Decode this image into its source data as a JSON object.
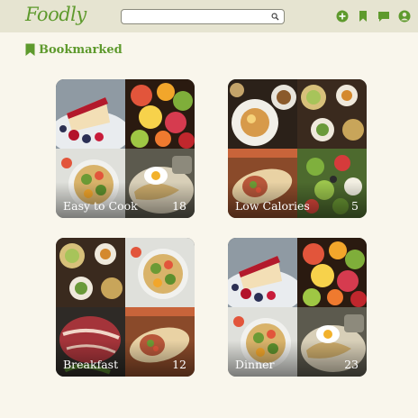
{
  "app": {
    "logo": "Foodly"
  },
  "search": {
    "placeholder": "",
    "value": ""
  },
  "nav": {
    "icons": [
      "add-circle-icon",
      "bookmark-icon",
      "chat-icon",
      "profile-icon"
    ]
  },
  "page": {
    "heading": "Bookmarked"
  },
  "collections": [
    {
      "name": "Easy to Cook",
      "count": "18",
      "images": [
        "cheesecake",
        "fruit-platter",
        "salad-bowl",
        "egg-noodles"
      ]
    },
    {
      "name": "Low Calories",
      "count": "5",
      "images": [
        "breakfast-plates",
        "spread-table",
        "burrito",
        "greek-salad"
      ]
    },
    {
      "name": "Breakfast",
      "count": "12",
      "images": [
        "spread-table",
        "salad-bowl",
        "raw-steak",
        "burrito"
      ]
    },
    {
      "name": "Dinner",
      "count": "23",
      "images": [
        "cheesecake",
        "fruit-platter",
        "salad-bowl",
        "egg-noodles"
      ]
    }
  ],
  "colors": {
    "brand": "#5e9a2d",
    "background": "#f9f6ec",
    "topbar": "#e6e4d1"
  }
}
